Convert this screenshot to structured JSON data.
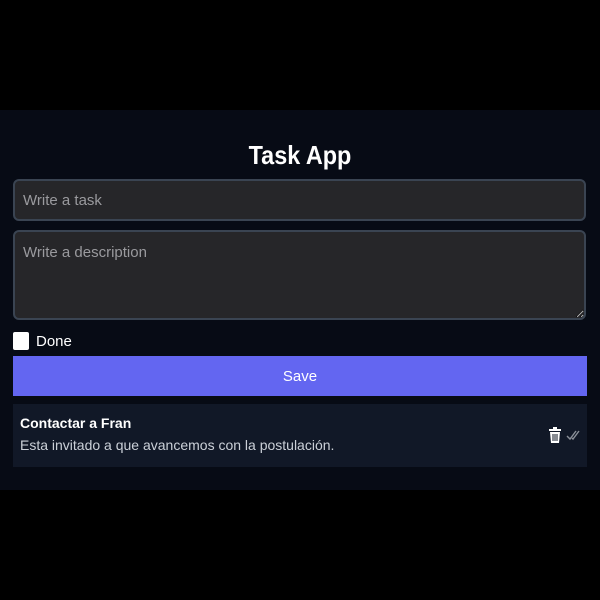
{
  "app": {
    "title": "Task App"
  },
  "form": {
    "task_placeholder": "Write a task",
    "description_placeholder": "Write a description",
    "done_label": "Done",
    "done_checked": false,
    "save_label": "Save"
  },
  "tasks": [
    {
      "title": "Contactar a Fran",
      "description": "Esta invitado a que avancemos con la postulación.",
      "done": false,
      "actions": [
        "trash-icon",
        "double-check-icon"
      ]
    }
  ],
  "colors": {
    "page_background": "#000000",
    "app_background": "#070b15",
    "input_background": "#262629",
    "input_border": "#3a4452",
    "accent": "#6366f1",
    "card_background": "#111827"
  }
}
